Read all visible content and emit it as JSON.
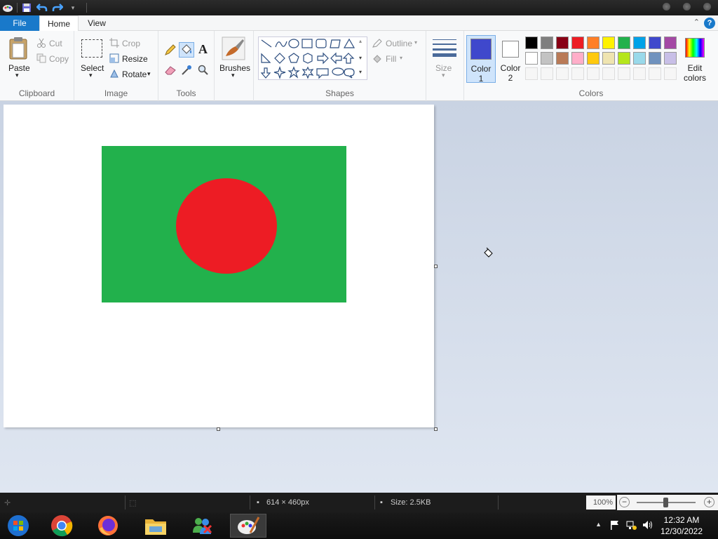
{
  "tabs": {
    "file": "File",
    "home": "Home",
    "view": "View"
  },
  "ribbon": {
    "clipboard": {
      "label": "Clipboard",
      "paste": "Paste",
      "cut": "Cut",
      "copy": "Copy"
    },
    "image": {
      "label": "Image",
      "select": "Select",
      "crop": "Crop",
      "resize": "Resize",
      "rotate": "Rotate"
    },
    "tools": {
      "label": "Tools"
    },
    "brushes": {
      "label": "Brushes"
    },
    "shapes": {
      "label": "Shapes",
      "outline": "Outline",
      "fill": "Fill"
    },
    "size": {
      "label": "Size"
    },
    "colors": {
      "label": "Colors",
      "color1_line1": "Color",
      "color1_line2": "1",
      "color2_line1": "Color",
      "color2_line2": "2",
      "edit_line1": "Edit",
      "edit_line2": "colors",
      "color1_value": "#3f48cc",
      "color2_value": "#ffffff",
      "row1": [
        "#000000",
        "#7f7f7f",
        "#880015",
        "#ed1c24",
        "#ff7f27",
        "#fff200",
        "#22b14c",
        "#00a2e8",
        "#3f48cc",
        "#a349a4"
      ],
      "row2": [
        "#ffffff",
        "#c3c3c3",
        "#b97a57",
        "#ffaec9",
        "#ffc90e",
        "#efe4b0",
        "#b5e61d",
        "#99d9ea",
        "#7092be",
        "#c8bfe7"
      ]
    }
  },
  "canvas": {
    "flag_green": "#22b14c",
    "flag_red": "#ed1c24"
  },
  "status": {
    "dimensions": "614 × 460px",
    "size": "Size: 2.5KB",
    "zoom": "100%"
  },
  "taskbar": {
    "apps": [
      "start-orb",
      "chrome",
      "firefox",
      "file-explorer",
      "messenger",
      "paint"
    ],
    "time": "12:32 AM",
    "date": "12/30/2022"
  }
}
